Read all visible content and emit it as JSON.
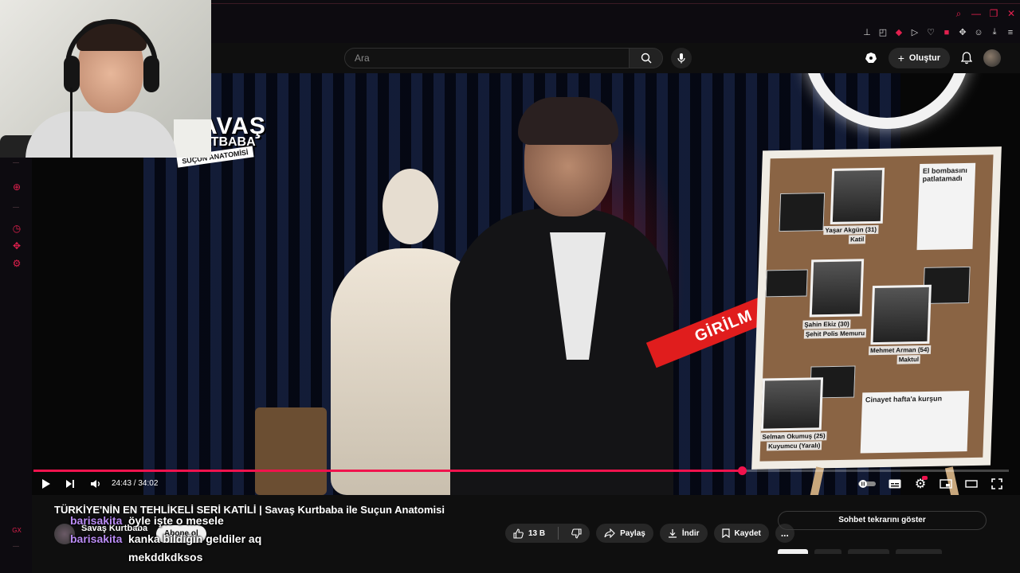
{
  "browser": {
    "window_controls": [
      "search",
      "minimize",
      "restore",
      "close"
    ],
    "extensions": [
      "pin-icon",
      "snapshot-icon",
      "pocket-icon",
      "play-icon",
      "heart-icon",
      "gx-icon",
      "puzzle-icon",
      "profile-icon",
      "download-icon",
      "menu-icon"
    ],
    "sidebar_icons": [
      "add-icon",
      "history-icon",
      "extensions-icon",
      "settings-icon"
    ],
    "sidebar_bottom_label": "GX",
    "accent_color": "#e2204e"
  },
  "header": {
    "search_placeholder": "Ara",
    "create_label": "Oluştur"
  },
  "video": {
    "logo_line1": "SAVAŞ",
    "logo_line2": "KURTBABA İLE",
    "logo_line3": "SUÇUN ANATOMİSİ",
    "tape_text": "GİRİLM",
    "board": {
      "news1": "El bombasını patlatamadı",
      "news2": "Cinayet hafta'a kurşun",
      "person1": "Yaşar Akgün (31)",
      "person1_role": "Katil",
      "person2": "Şahin Ekiz (30)",
      "person2_role": "Şehit Polis Memuru",
      "person3": "Mehmet Arman (54)",
      "person3_role": "Maktul",
      "person4": "Selman Okumuş (25)",
      "person4_role": "Kuyumcu (Yaralı)"
    }
  },
  "player": {
    "current_time": "24:43",
    "duration": "34:02",
    "time_display": "24:43 / 34:02",
    "progress": 0.7265
  },
  "below": {
    "title": "TÜRKİYE'NİN EN TEHLİKELİ SERİ KATİLİ | Savaş Kurtbaba ile Suçun Anatomisi",
    "channel_name": "Savaş Kurtbaba",
    "subscribe_label": "Abone ol",
    "like_count": "13 B",
    "share_label": "Paylaş",
    "download_label": "İndir",
    "save_label": "Kaydet",
    "more_label": "...",
    "chat_replay_label": "Sohbet tekrarını göster"
  },
  "chat": [
    {
      "user": "barisakita",
      "message": "öyle işte o mesele"
    },
    {
      "user": "barisakita",
      "message": "kanka bildiğin geldiler aq"
    },
    {
      "user": "",
      "message": "mekddkdksos"
    }
  ]
}
